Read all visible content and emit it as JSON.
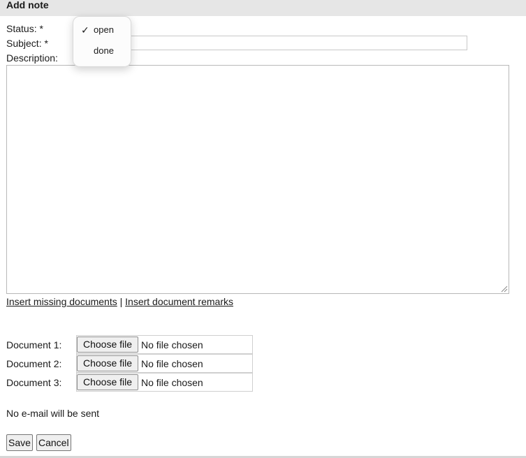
{
  "window": {
    "title": "Add note"
  },
  "form": {
    "status_label": "Status: *",
    "subject_label": "Subject: *",
    "description_label": "Description:",
    "subject_value": "",
    "description_value": ""
  },
  "status_dropdown": {
    "options": [
      {
        "label": "open",
        "selected": true
      },
      {
        "label": "done",
        "selected": false
      }
    ],
    "check_glyph": "✓"
  },
  "links": {
    "missing_docs": "Insert missing documents",
    "separator": "|",
    "doc_remarks": "Insert document remarks"
  },
  "documents": [
    {
      "label": "Document 1:",
      "button": "Choose file",
      "status": "No file chosen"
    },
    {
      "label": "Document 2:",
      "button": "Choose file",
      "status": "No file chosen"
    },
    {
      "label": "Document 3:",
      "button": "Choose file",
      "status": "No file chosen"
    }
  ],
  "mail_note": "No e-mail will be sent",
  "actions": {
    "save": "Save",
    "cancel": "Cancel"
  }
}
